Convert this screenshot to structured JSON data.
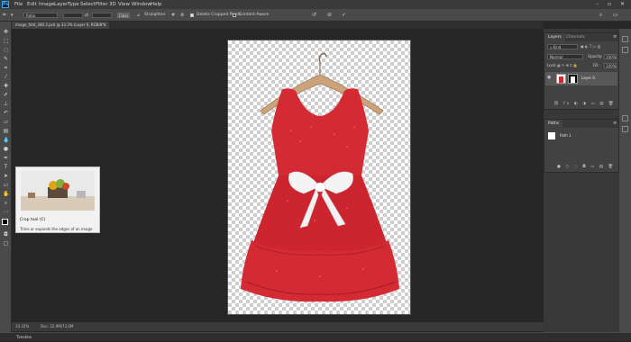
{
  "menubar": {
    "logo": "Ps",
    "items": [
      "File",
      "Edit",
      "Image",
      "Layer",
      "Type",
      "Select",
      "Filter",
      "3D",
      "View",
      "Window",
      "Help"
    ]
  },
  "options": {
    "ratio": "Ratio",
    "clear": "Clear",
    "straighten": "Straighten",
    "delete_cropped": "Delete Cropped Pixels",
    "content_aware": "Content-Aware"
  },
  "document": {
    "tab": "image_fotd_380.2.psd @ 33.3% (Layer 0, RGB/8*)"
  },
  "status": {
    "zoom": "33.33%",
    "doc": "Doc: 22.9M/73.0M"
  },
  "timeline": {
    "label": "Timeline"
  },
  "layers_panel": {
    "tabs": [
      "Layers",
      "Channels"
    ],
    "kind": "Kind",
    "blend": "Normal",
    "opacity_label": "Opacity:",
    "opacity": "100%",
    "lock_label": "Lock:",
    "fill_label": "Fill:",
    "fill": "100%",
    "layer_name": "Layer 0"
  },
  "paths_panel": {
    "tab": "Paths",
    "path_name": "Path 1"
  },
  "tooltip": {
    "title": "Crop tool (C)",
    "desc": "Trims or expands the edges of an image"
  },
  "colors": {
    "accent": "#31a8ff",
    "dress": "#d42a33",
    "bow": "#f4f4f4"
  }
}
